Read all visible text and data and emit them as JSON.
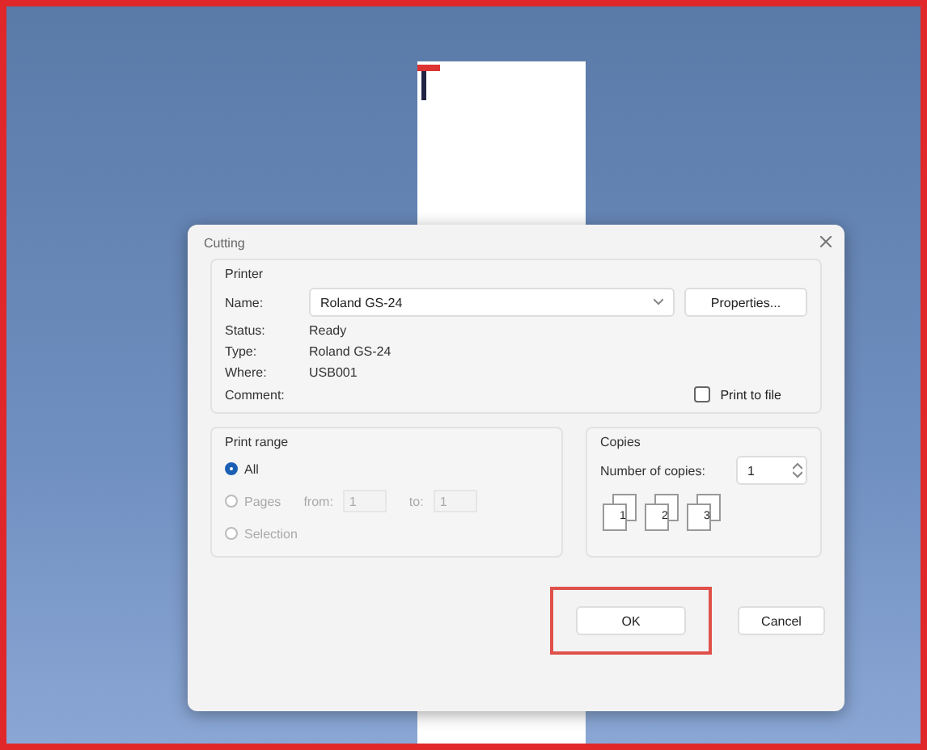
{
  "window": {
    "title": "Cutting"
  },
  "printer": {
    "heading": "Printer",
    "name_label": "Name:",
    "name": "Roland GS-24",
    "properties_button": "Properties...",
    "fields": [
      {
        "label": "Status:",
        "value": "Ready"
      },
      {
        "label": "Type:",
        "value": "Roland GS-24"
      },
      {
        "label": "Where:",
        "value": "USB001"
      }
    ],
    "comment_label": "Comment:",
    "print_to_file": {
      "label": "Print to file",
      "checked": false
    }
  },
  "print_range": {
    "heading": "Print range",
    "options": [
      {
        "kind": "plain",
        "label": "All",
        "selected": true,
        "disabled": false
      },
      {
        "kind": "pages",
        "label": "Pages",
        "selected": false,
        "disabled": true,
        "from_label": "from:",
        "from": "1",
        "to_label": "to:",
        "to": "1"
      },
      {
        "kind": "plain",
        "label": "Selection",
        "selected": false,
        "disabled": true
      }
    ]
  },
  "copies": {
    "heading": "Copies",
    "label": "Number of copies:",
    "value": "1",
    "collate_labels": [
      "1",
      "2",
      "3"
    ]
  },
  "buttons": [
    {
      "label": "OK",
      "highlighted": true
    },
    {
      "label": "Cancel",
      "highlighted": false
    }
  ]
}
